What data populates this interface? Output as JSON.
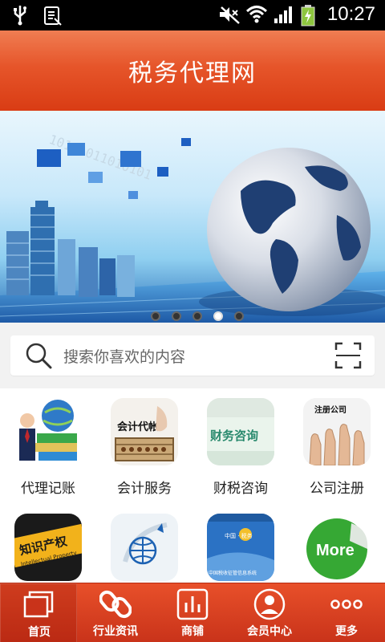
{
  "status_bar": {
    "time": "10:27",
    "icons": [
      "usb-icon",
      "sim-icon",
      "mute-icon",
      "wifi-icon",
      "signal-icon",
      "battery-icon"
    ]
  },
  "header": {
    "title": "税务代理网"
  },
  "banner": {
    "slides": 5,
    "active_slide": 4,
    "image": "city-globe-banner"
  },
  "search": {
    "placeholder": "搜索你喜欢的内容"
  },
  "categories": [
    {
      "label": "代理记账",
      "icon": "books-businessman"
    },
    {
      "label": "会计服务",
      "icon": "abacus",
      "tile_text": "会计代帐"
    },
    {
      "label": "财税咨询",
      "icon": "finance-consult",
      "tile_text": "财务咨询"
    },
    {
      "label": "公司注册",
      "icon": "thumbs-up",
      "tile_text": "注册公司"
    },
    {
      "label": "",
      "icon": "intellectual-property",
      "tile_text": "知识产权",
      "tile_subtext": "Intellectual Property"
    },
    {
      "label": "",
      "icon": "globe-rocket"
    },
    {
      "label": "",
      "icon": "tax-system",
      "tile_text": "中国 · 税务",
      "tile_subtext": "中国税收征管信息系统"
    },
    {
      "label": "",
      "icon": "more-sticker",
      "tile_text": "More"
    }
  ],
  "nav": [
    {
      "label": "首页",
      "icon": "home-icon",
      "active": true
    },
    {
      "label": "行业资讯",
      "icon": "link-icon",
      "active": false
    },
    {
      "label": "商铺",
      "icon": "store-icon",
      "active": false
    },
    {
      "label": "会员中心",
      "icon": "member-icon",
      "active": false
    },
    {
      "label": "更多",
      "icon": "more-icon",
      "active": false
    }
  ],
  "colors": {
    "header": "#e6552a",
    "nav": "#d63e1c",
    "accent": "#ffffff"
  }
}
